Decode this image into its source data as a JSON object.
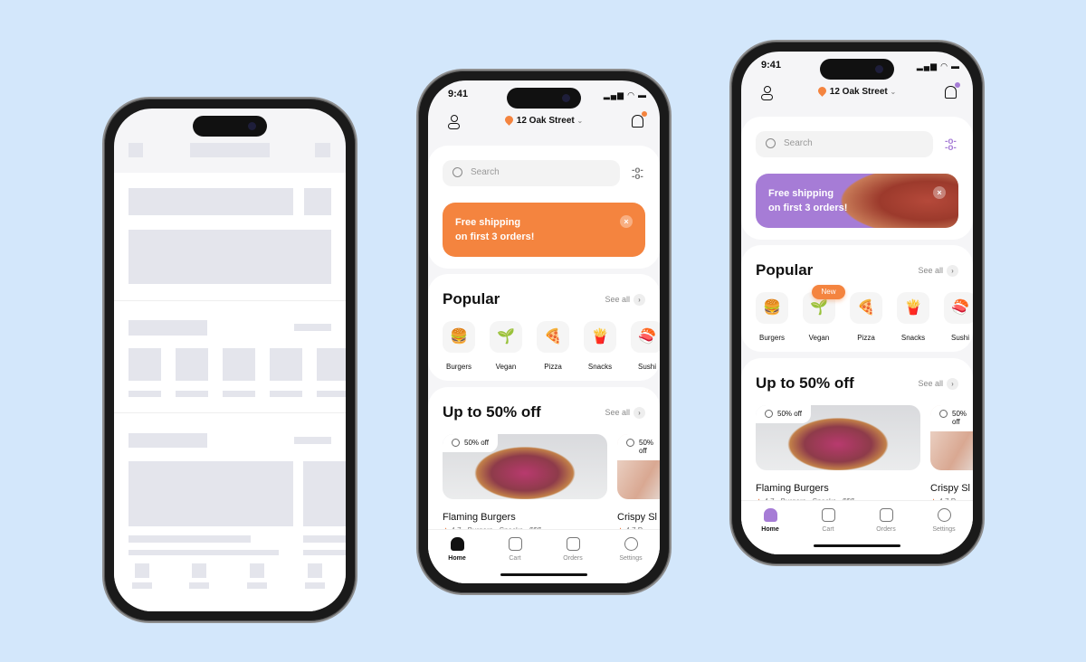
{
  "status_time": "9:41",
  "location": "12 Oak Street",
  "search_placeholder": "Search",
  "banner": {
    "line1": "Free shipping",
    "line2": "on first 3 orders!",
    "close": "×"
  },
  "popular": {
    "title": "Popular",
    "see_all": "See all",
    "badge": "New",
    "items": [
      {
        "label": "Burgers",
        "icon": "🍔"
      },
      {
        "label": "Vegan",
        "icon": "🌱"
      },
      {
        "label": "Pizza",
        "icon": "🍕"
      },
      {
        "label": "Snacks",
        "icon": "🍟"
      },
      {
        "label": "Sushi",
        "icon": "🍣"
      }
    ]
  },
  "deals": {
    "title": "Up to 50% off",
    "see_all": "See all",
    "cards": [
      {
        "tag": "50% off",
        "name": "Flaming Burgers",
        "rating": "4.7",
        "meta": "Burgers · Snacks · $$$"
      },
      {
        "tag": "50% off",
        "name": "Crispy Sl",
        "rating": "4.7",
        "meta": "P"
      }
    ]
  },
  "nav": [
    {
      "label": "Home",
      "icon": "home-icon"
    },
    {
      "label": "Cart",
      "icon": "cart-icon"
    },
    {
      "label": "Orders",
      "icon": "orders-icon"
    },
    {
      "label": "Settings",
      "icon": "settings-icon"
    }
  ],
  "themes": {
    "orange": "#f4843f",
    "purple": "#a67cd6"
  }
}
